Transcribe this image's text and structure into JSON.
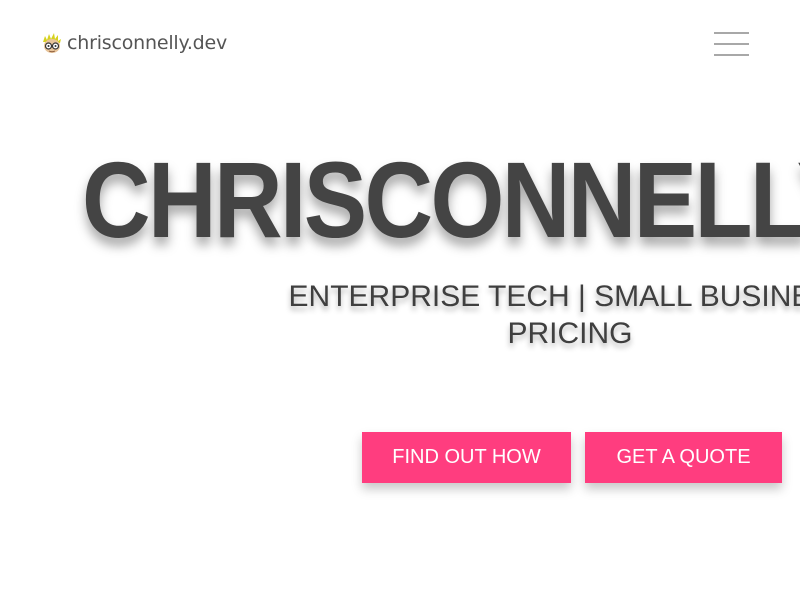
{
  "colors": {
    "accent": "#ff3d7f",
    "title_text": "#444444",
    "logo_text": "#555555",
    "menu_bars": "#a8a8a8",
    "background": "#ffffff"
  },
  "header": {
    "logo_icon": "cartoon-face-with-glasses-icon",
    "logo_text": "chrisconnelly.dev",
    "menu_icon": "hamburger-menu-icon"
  },
  "hero": {
    "title": "CHRISCONNELLY",
    "subtitle_line1": "ENTERPRISE TECH | SMALL BUSINESS",
    "subtitle_line2": "PRICING",
    "buttons": {
      "find_out_how": "FIND OUT HOW",
      "get_a_quote": "GET A QUOTE"
    }
  }
}
